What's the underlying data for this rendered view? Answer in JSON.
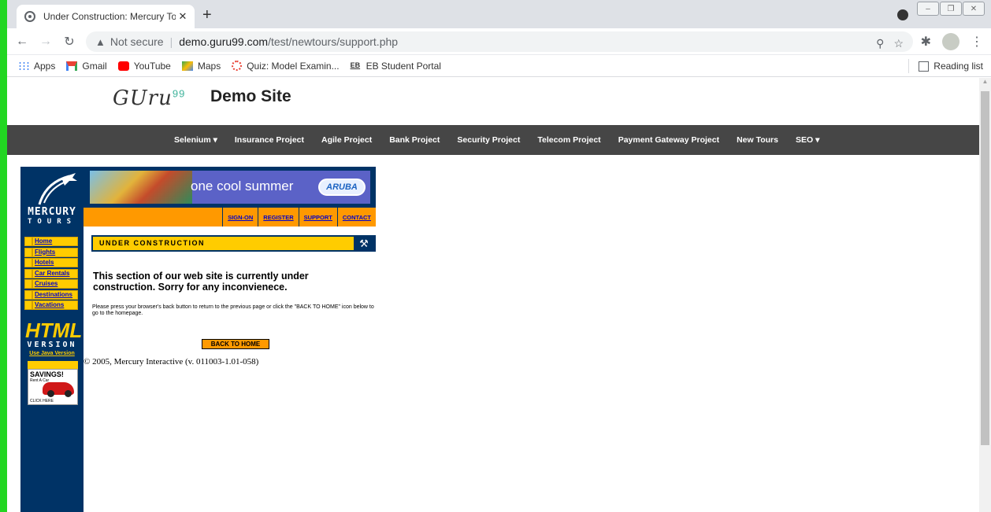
{
  "browser": {
    "tab_title": "Under Construction: Mercury Tou",
    "tab_close": "✕",
    "new_tab": "+",
    "security_label": "Not secure",
    "url_host": "demo.guru99.com",
    "url_path": "/test/newtours/support.php",
    "bookmarks": [
      {
        "label": "Apps",
        "icon": "apps-icon"
      },
      {
        "label": "Gmail",
        "icon": "gmail-icon"
      },
      {
        "label": "YouTube",
        "icon": "youtube-icon"
      },
      {
        "label": "Maps",
        "icon": "maps-icon"
      },
      {
        "label": "Quiz: Model Examin...",
        "icon": "quiz-icon"
      },
      {
        "label": "EB Student Portal",
        "icon": "portal-icon"
      }
    ],
    "reading_list": "Reading list"
  },
  "site": {
    "logo_text": "GUru",
    "logo_sup": "99",
    "title": "Demo Site",
    "nav": [
      "Selenium ▾",
      "Insurance Project",
      "Agile Project",
      "Bank Project",
      "Security Project",
      "Telecom Project",
      "Payment Gateway Project",
      "New Tours",
      "SEO ▾"
    ]
  },
  "mercury": {
    "brand_line1": "MERCURY",
    "brand_line2": "TOURS",
    "side_links": [
      "Home",
      "Flights",
      "Hotels",
      "Car Rentals",
      "Cruises",
      "Destinations",
      "Vacations"
    ],
    "html_version": "HTML",
    "version_word": "VERSION",
    "java_link": "Use Java Version",
    "savings": "SAVINGS!",
    "rent_car": "Rent A Car",
    "click_here": "CLICK HERE",
    "banner_text": "one cool summer",
    "aruba": "ARUBA",
    "top_links": [
      "SIGN-ON",
      "REGISTER",
      "SUPPORT",
      "CONTACT"
    ],
    "uc_label": "UNDER CONSTRUCTION",
    "uc_main": "This section of our web site is currently under construction.   Sorry for any inconvienece.",
    "uc_sub": "Please press your browser's back button to return to the previous page or click the \"BACK TO HOME\" icon below to go to the homepage.",
    "back_home": "BACK TO HOME",
    "copyright": "© 2005, Mercury Interactive (v. 011003-1.01-058)"
  },
  "colors": {
    "green_bar": "#22d622",
    "nav_bg": "#464646",
    "mercury_blue": "#003366",
    "mercury_orange": "#ff9900",
    "mercury_yellow": "#ffcc00"
  }
}
